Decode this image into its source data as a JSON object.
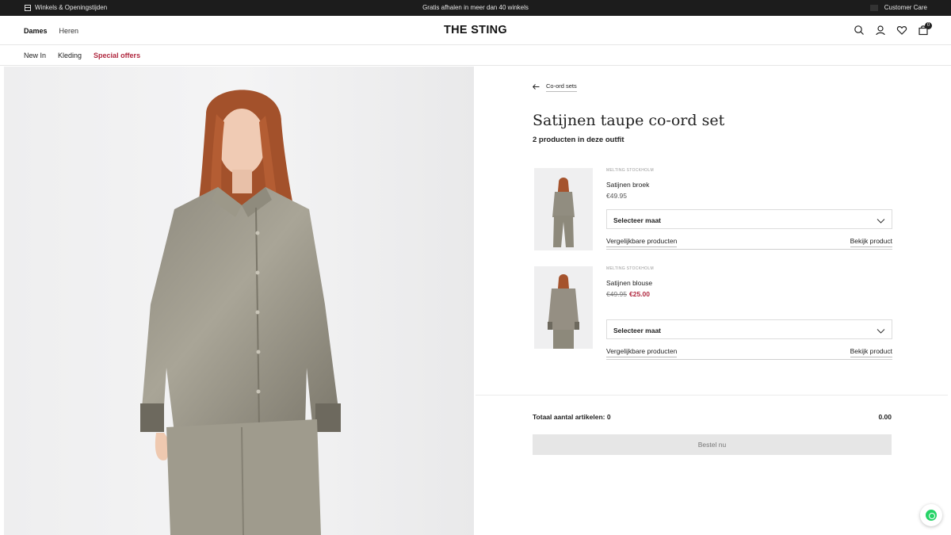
{
  "topbar": {
    "stores": "Winkels & Openingstijden",
    "promo": "Gratis afhalen in meer dan 40 winkels",
    "customer_care": "Customer Care"
  },
  "header": {
    "logo": "THE STING",
    "gender": [
      "Dames",
      "Heren"
    ],
    "cart_count": "0",
    "icons": [
      "search-icon",
      "account-icon",
      "heart-icon",
      "bag-icon"
    ]
  },
  "subnav": [
    "New In",
    "Kleding",
    "Special offers"
  ],
  "colors": {
    "special": "#b0283f",
    "sale": "#b0283f",
    "topbar": "#1c1c1c",
    "whatsapp": "#25d366"
  },
  "outfit": {
    "back_label": "Co-ord sets",
    "title": "Satijnen taupe co-ord set",
    "subtitle": "2 producten in deze outfit",
    "products": [
      {
        "brand": "MELTING STOCKHOLM",
        "name": "Satijnen broek",
        "price": "€49.95",
        "select": "Selecteer maat",
        "similar": "Vergelijkbare producten",
        "view": "Bekijk product"
      },
      {
        "brand": "MELTING STOCKHOLM",
        "name": "Satijnen blouse",
        "old_price": "€49.95",
        "new_price": "€25.00",
        "select": "Selecteer maat",
        "similar": "Vergelijkbare producten",
        "view": "Bekijk product"
      }
    ],
    "total_label": "Totaal aantal artikelen: 0",
    "total_amount": "0.00",
    "order_button": "Bestel nu"
  }
}
